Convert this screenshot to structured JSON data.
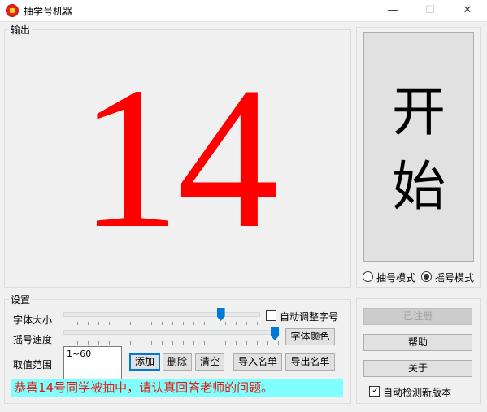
{
  "window": {
    "title": "抽学号机器",
    "minimize": "—",
    "maximize": "☐",
    "close": "✕"
  },
  "output": {
    "label": "输出",
    "number": "14"
  },
  "start_button": {
    "chars": [
      "开",
      "始"
    ]
  },
  "modes": [
    {
      "label": "抽号模式",
      "selected": false
    },
    {
      "label": "摇号模式",
      "selected": true
    }
  ],
  "settings": {
    "label": "设置",
    "font_size_label": "字体大小",
    "speed_label": "摇号速度",
    "range_label": "取值范围",
    "font_size_value": 0.82,
    "speed_value": 1.0,
    "auto_font_label": "自动调整字号",
    "auto_font_checked": false,
    "font_color_button": "字体颜色",
    "range_text": "1~60",
    "buttons": [
      "添加",
      "删除",
      "清空",
      "导入名单",
      "导出名单"
    ]
  },
  "status_text": "恭喜14号同学被抽中，请认真回答老师的问题。",
  "right_panel": {
    "registered_button": "已注册",
    "help_button": "帮助",
    "about_button": "关于",
    "auto_update_label": "自动检测新版本",
    "auto_update_checked": true
  },
  "colors": {
    "number": "#ff0000",
    "status_bg": "#80ffff",
    "status_text": "#e8170f",
    "accent": "#0078d7"
  }
}
